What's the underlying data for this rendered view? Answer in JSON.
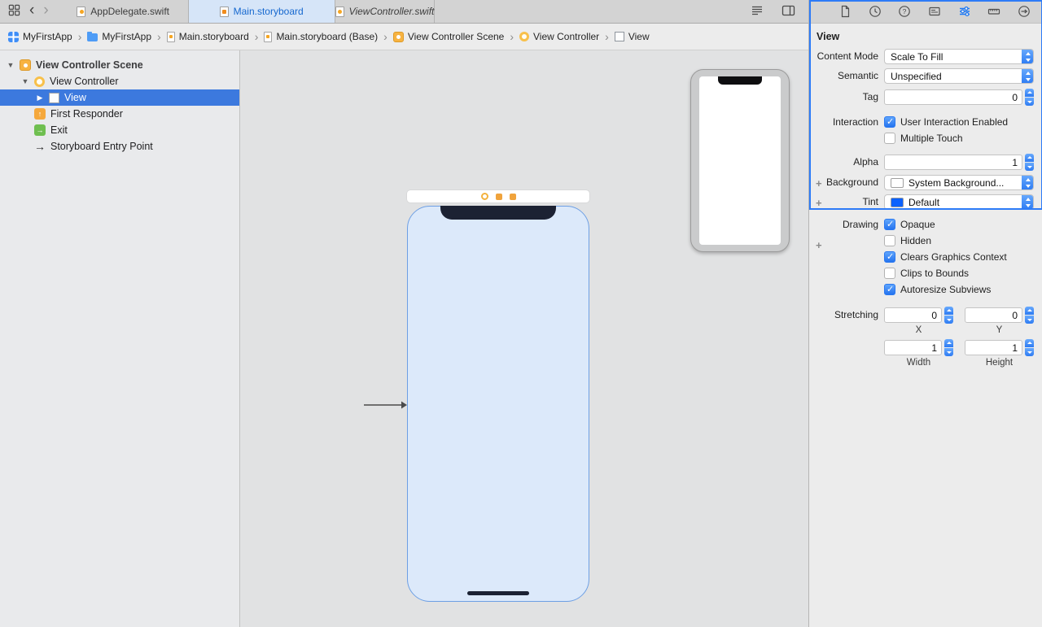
{
  "tab_bar": {
    "tabs": [
      {
        "label": "AppDelegate.swift"
      },
      {
        "label": "Main.storyboard"
      },
      {
        "label": "ViewController.swift"
      }
    ],
    "left_icons": [
      "tab-overview-icon",
      "back-icon",
      "forward-icon"
    ],
    "right_icons": [
      "assistant-lines-icon",
      "editor-layout-icon"
    ]
  },
  "jump_bar": {
    "items": [
      {
        "label": "MyFirstApp",
        "icon": "app-icon"
      },
      {
        "label": "MyFirstApp",
        "icon": "folder-icon"
      },
      {
        "label": "Main.storyboard",
        "icon": "storyboard-file-icon"
      },
      {
        "label": "Main.storyboard (Base)",
        "icon": "storyboard-file-icon"
      },
      {
        "label": "View Controller Scene",
        "icon": "scene-icon"
      },
      {
        "label": "View Controller",
        "icon": "view-controller-icon"
      },
      {
        "label": "View",
        "icon": "view-icon"
      }
    ]
  },
  "outline": {
    "scene": "View Controller Scene",
    "view_controller": "View Controller",
    "view": "View",
    "first_responder": "First Responder",
    "exit": "Exit",
    "entry_point": "Storyboard Entry Point"
  },
  "inspector": {
    "title": "View",
    "toolbar_icons": [
      "file-inspector-icon",
      "history-inspector-icon",
      "quick-help-icon",
      "identity-inspector-icon",
      "attributes-inspector-icon",
      "size-inspector-icon",
      "connections-inspector-icon"
    ],
    "active_toolbar_icon": "attributes-inspector-icon",
    "rows": {
      "content_mode": {
        "label": "Content Mode",
        "value": "Scale To Fill"
      },
      "semantic": {
        "label": "Semantic",
        "value": "Unspecified"
      },
      "tag": {
        "label": "Tag",
        "value": "0"
      },
      "interaction": {
        "label": "Interaction"
      },
      "alpha": {
        "label": "Alpha",
        "value": "1"
      },
      "background": {
        "label": "Background",
        "value": "System Background...",
        "swatch_style": "background:#ffffff"
      },
      "tint": {
        "label": "Tint",
        "value": "Default",
        "swatch_style": "background:#0b61fe"
      },
      "drawing": {
        "label": "Drawing"
      },
      "stretching": {
        "label": "Stretching"
      }
    },
    "checkboxes": {
      "user_interaction": {
        "label": "User Interaction Enabled",
        "checked": true
      },
      "multiple_touch": {
        "label": "Multiple Touch",
        "checked": false
      },
      "opaque": {
        "label": "Opaque",
        "checked": true
      },
      "hidden": {
        "label": "Hidden",
        "checked": false
      },
      "clears": {
        "label": "Clears Graphics Context",
        "checked": true
      },
      "clips": {
        "label": "Clips to Bounds",
        "checked": false
      },
      "autoresize": {
        "label": "Autoresize Subviews",
        "checked": true
      }
    },
    "stretching_fields": {
      "x": {
        "label": "X",
        "value": "0"
      },
      "y": {
        "label": "Y",
        "value": "0"
      },
      "width": {
        "label": "Width",
        "value": "1"
      },
      "height": {
        "label": "Height",
        "value": "1"
      }
    }
  },
  "colors": {
    "accent_blue": "#2d7bf7",
    "selection_blue": "#3c79de",
    "tint_default": "#0b61fe",
    "storyboard_view_fill": "#dce9fa"
  }
}
